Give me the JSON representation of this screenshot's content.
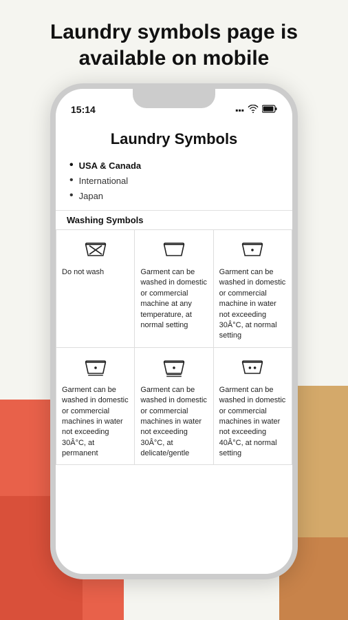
{
  "page": {
    "headline": "Laundry symbols page is available on mobile"
  },
  "status_bar": {
    "time": "15:14"
  },
  "app": {
    "title": "Laundry Symbols",
    "nav": [
      {
        "label": "USA & Canada",
        "active": true
      },
      {
        "label": "International",
        "active": false
      },
      {
        "label": "Japan",
        "active": false
      }
    ],
    "section": "Washing Symbols",
    "table": {
      "rows": [
        [
          {
            "symbol": "do-not-wash",
            "text": "Do not wash"
          },
          {
            "symbol": "wash-any-temp",
            "text": "Garment can be washed in domestic or commercial machine at any temperature, at normal setting"
          },
          {
            "symbol": "wash-30",
            "text": "Garment can be washed in domestic or commercial machine in water not exceeding 30Â°C, at normal setting"
          }
        ],
        [
          {
            "symbol": "wash-30-perm",
            "text": "Garment can be washed in domestic or commercial machines in water not exceeding 30Â°C, at permanent"
          },
          {
            "symbol": "wash-30-delicate",
            "text": "Garment can be washed in domestic or commercial machines in water not exceeding 30Â°C, at delicate/gentle"
          },
          {
            "symbol": "wash-40",
            "text": "Garment can be washed in domestic or commercial machines in water not exceeding 40Â°C, at normal setting"
          }
        ]
      ]
    }
  }
}
